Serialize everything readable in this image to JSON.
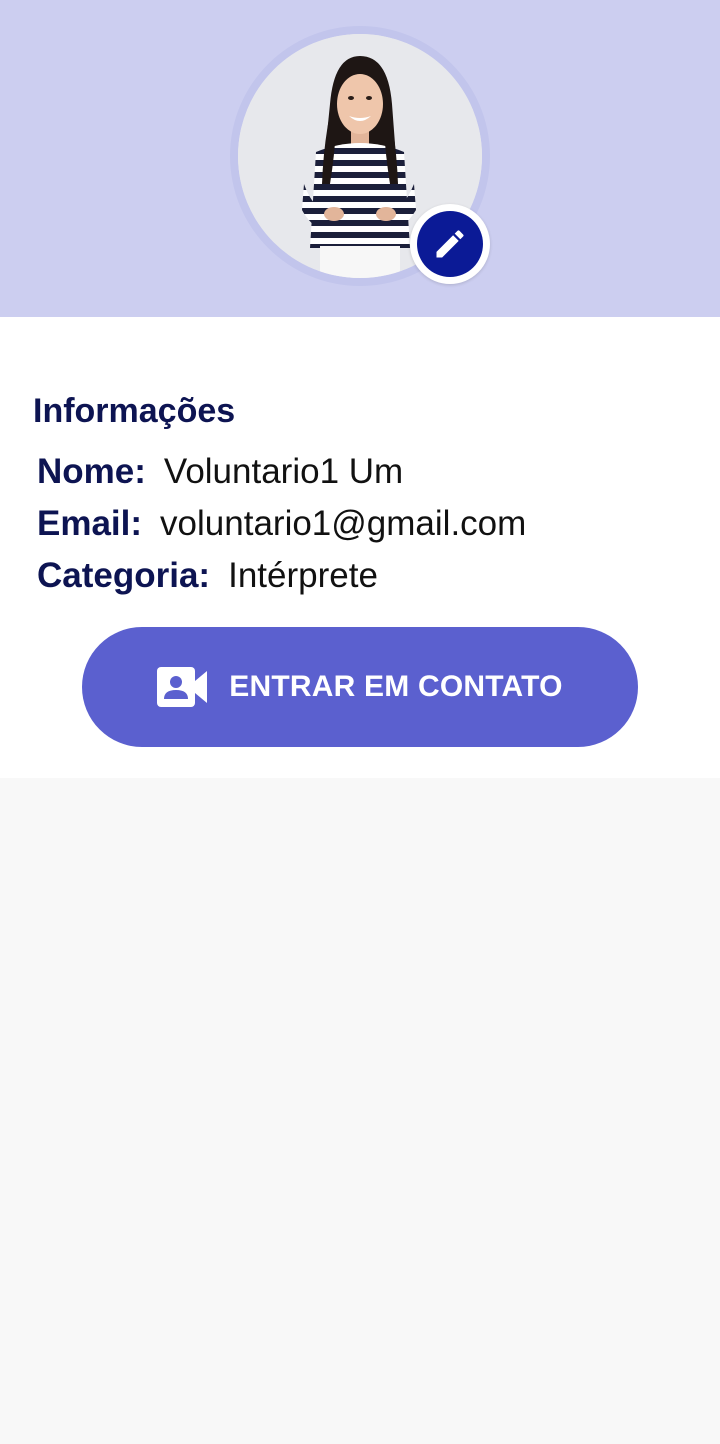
{
  "profile": {
    "avatar_icon": "profile-photo",
    "edit_icon": "pencil-icon"
  },
  "info": {
    "title": "Informações",
    "fields": [
      {
        "label": "Nome:",
        "value": "Voluntario1 Um"
      },
      {
        "label": "Email:",
        "value": "voluntario1@gmail.com"
      },
      {
        "label": "Categoria:",
        "value": "Intérprete"
      }
    ]
  },
  "contact_button": {
    "label": "ENTRAR EM CONTATO",
    "icon": "video-contact-icon"
  },
  "colors": {
    "header_bg": "#cccef0",
    "edit_button": "#0b1a96",
    "primary_button": "#5b60cf",
    "label_text": "#0d1452",
    "page_bg": "#f8f8f8"
  }
}
